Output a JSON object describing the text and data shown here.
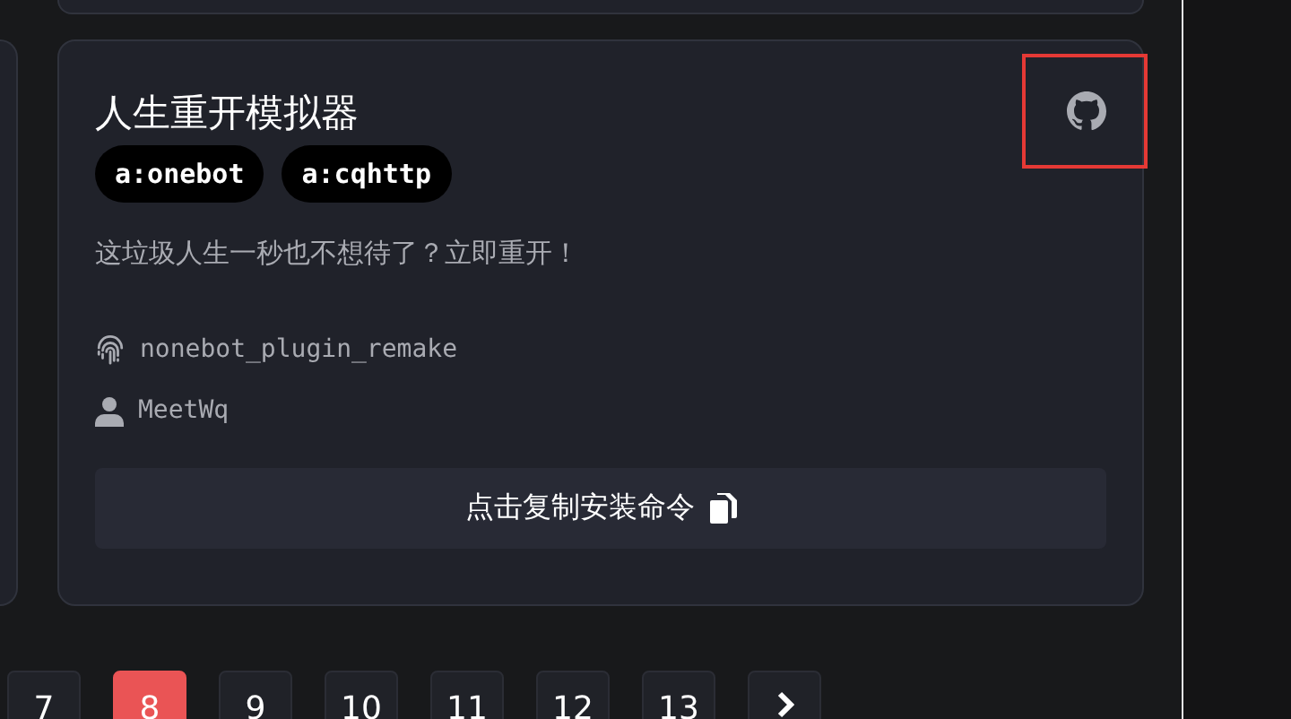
{
  "card": {
    "title": "人生重开模拟器",
    "tags": [
      "a:onebot",
      "a:cqhttp"
    ],
    "description": "这垃圾人生一秒也不想待了？立即重开！",
    "module": "nonebot_plugin_remake",
    "author": "MeetWq",
    "copy_button": "点击复制安装命令"
  },
  "pagination": [
    {
      "kind": "page",
      "label": "7",
      "selected": false
    },
    {
      "kind": "page",
      "label": "8",
      "selected": true
    },
    {
      "kind": "page",
      "label": "9",
      "selected": false
    },
    {
      "kind": "page",
      "label": "10",
      "selected": false
    },
    {
      "kind": "page",
      "label": "11",
      "selected": false
    },
    {
      "kind": "page",
      "label": "12",
      "selected": false
    },
    {
      "kind": "page",
      "label": "13",
      "selected": false
    },
    {
      "kind": "next",
      "selected": false
    }
  ]
}
